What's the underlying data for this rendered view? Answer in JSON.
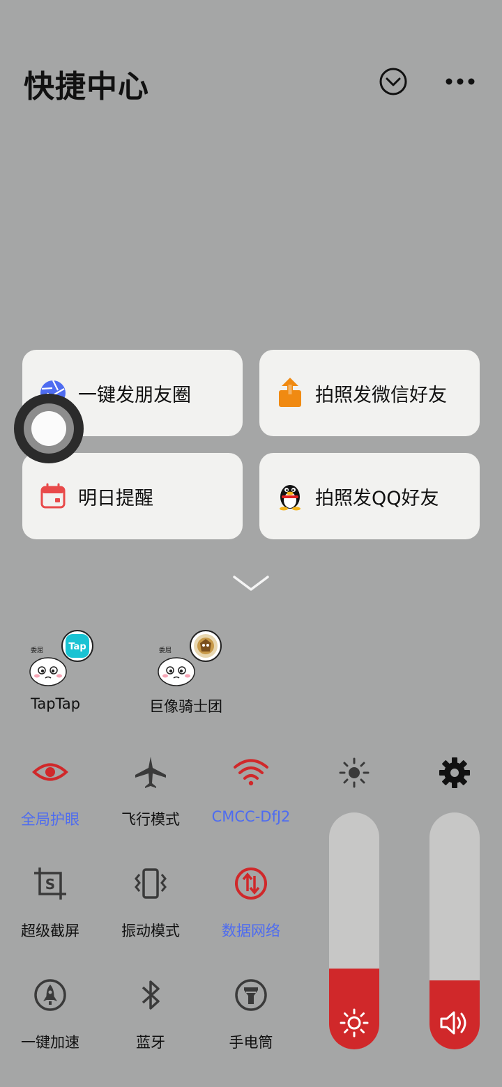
{
  "header": {
    "title": "快捷中心",
    "collapse_icon": "chevron-circle-down-icon",
    "more_icon": "more-horizontal-icon"
  },
  "shortcuts": [
    {
      "label": "一键发朋友圈",
      "icon": "camera-shutter-icon",
      "color": "#4e6cf0"
    },
    {
      "label": "拍照发微信好友",
      "icon": "share-upload-icon",
      "color": "#f08a12"
    },
    {
      "label": "明日提醒",
      "icon": "calendar-icon",
      "color": "#e84a4a"
    },
    {
      "label": "拍照发QQ好友",
      "icon": "qq-penguin-icon",
      "color": "#111111"
    }
  ],
  "recent_apps": [
    {
      "name": "TapTap",
      "badge_text": "Tap",
      "badge_color": "#19c3d3"
    },
    {
      "name": "巨像骑士团",
      "badge_text": "",
      "badge_color": "#c89a4a"
    }
  ],
  "toggles": [
    {
      "label": "全局护眼",
      "icon": "eye-icon",
      "active": true
    },
    {
      "label": "飞行模式",
      "icon": "airplane-icon",
      "active": false
    },
    {
      "label": "CMCC-DfJ2",
      "icon": "wifi-icon",
      "active": true
    },
    {
      "label": "超级截屏",
      "icon": "screenshot-icon",
      "active": false
    },
    {
      "label": "振动模式",
      "icon": "vibrate-icon",
      "active": false
    },
    {
      "label": "数据网络",
      "icon": "mobile-data-icon",
      "active": true
    },
    {
      "label": "一键加速",
      "icon": "rocket-icon",
      "active": false
    },
    {
      "label": "蓝牙",
      "icon": "bluetooth-icon",
      "active": false
    },
    {
      "label": "手电筒",
      "icon": "flashlight-icon",
      "active": false
    }
  ],
  "sliders": {
    "brightness": {
      "level": 0.34,
      "icon": "sun-icon",
      "top_icon": "brightness-auto-icon"
    },
    "volume": {
      "level": 0.29,
      "icon": "speaker-icon",
      "top_icon": "settings-gear-icon"
    }
  },
  "colors": {
    "background": "#a5a6a6",
    "card": "#f2f2f0",
    "active_red": "#d0282a",
    "active_blue": "#4e6cf0"
  }
}
